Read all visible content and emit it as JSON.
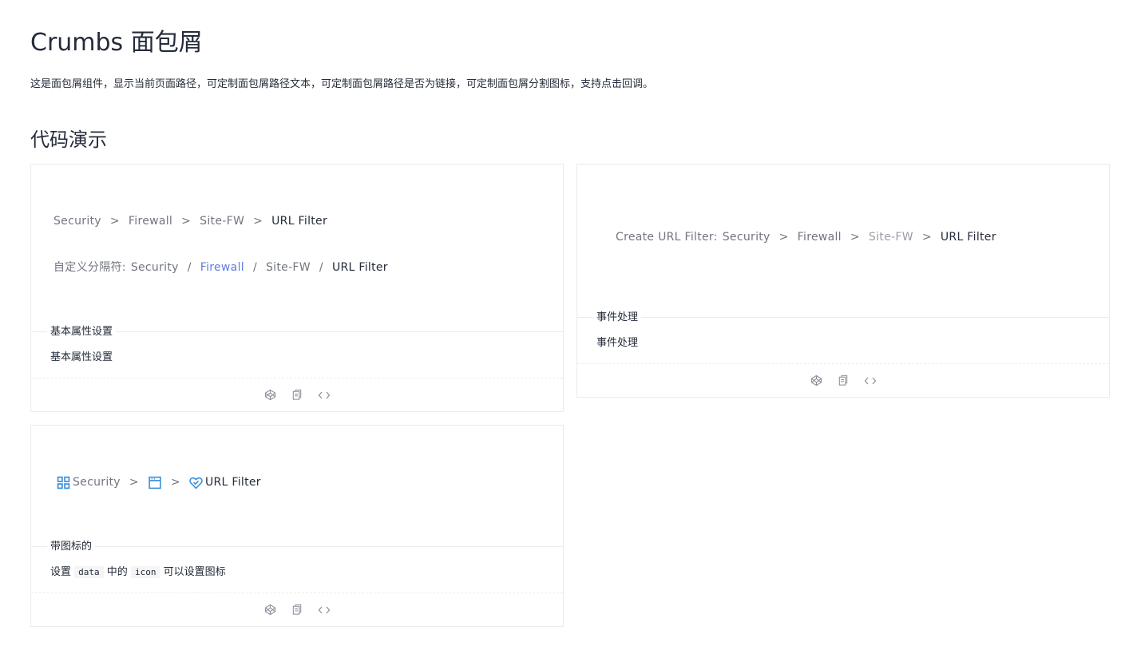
{
  "page": {
    "title": "Crumbs 面包屑",
    "description": "这是面包屑组件，显示当前页面路径，可定制面包屑路径文本，可定制面包屑路径是否为链接，可定制面包屑分割图标，支持点击回调。",
    "section_title": "代码演示"
  },
  "demos": {
    "basic": {
      "crumbs": [
        "Security",
        "Firewall",
        "Site-FW",
        "URL Filter"
      ],
      "separator": ">",
      "custom_prefix": "自定义分隔符:",
      "custom_crumbs": [
        "Security",
        "Firewall",
        "Site-FW",
        "URL Filter"
      ],
      "custom_separator": "/",
      "meta_title": "基本属性设置",
      "meta_desc": "基本属性设置"
    },
    "events": {
      "prefix": "Create URL Filter:",
      "crumbs": [
        "Security",
        "Firewall",
        "Site-FW",
        "URL Filter"
      ],
      "separator": ">",
      "meta_title": "事件处理",
      "meta_desc": "事件处理"
    },
    "icons": {
      "crumbs": [
        {
          "label": "Security",
          "icon": "grid-icon"
        },
        {
          "label": "",
          "icon": "window-icon"
        },
        {
          "label": "URL Filter",
          "icon": "heart-shield-icon"
        }
      ],
      "separator": ">",
      "meta_title": "带图标的",
      "meta_desc_before": "设置",
      "meta_code_1": "data",
      "meta_desc_middle": "中的",
      "meta_code_2": "icon",
      "meta_desc_after": "可以设置图标"
    }
  },
  "actions": [
    "codepen-icon",
    "copy-icon",
    "code-icon"
  ],
  "colors": {
    "link": "#5e7ce0",
    "icon": "#3a8fd8",
    "text": "#252b3a",
    "muted": "#71757f"
  }
}
